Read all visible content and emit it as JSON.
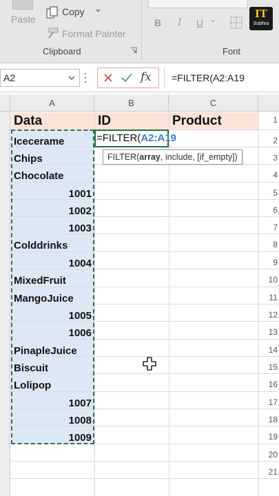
{
  "ribbon": {
    "paste_label": "Paste",
    "copy_label": "Copy",
    "copy_chevron": "⌄",
    "format_painter_label": "Format Painter",
    "clipboard_group": "Clipboard",
    "font_group": "Font",
    "bold": "B",
    "italic": "I",
    "underline": "U",
    "underline_chevron": "⌄",
    "logo_main": "IT",
    "logo_sub": "Subhra"
  },
  "formula_bar": {
    "name_box": "A2",
    "fx": "fx",
    "formula": "=FILTER(A2:A19"
  },
  "columns": [
    "A",
    "B",
    "C"
  ],
  "rows": [
    "1",
    "2",
    "3",
    "4",
    "5",
    "6",
    "7",
    "8",
    "9",
    "10",
    "11",
    "12",
    "13",
    "14",
    "15",
    "16",
    "17",
    "18",
    "19",
    "20",
    "21"
  ],
  "headers": {
    "data": "Data",
    "id": "ID",
    "product": "Product"
  },
  "cells": {
    "r2": "Icecerame",
    "r3": "Chips",
    "r4": "Chocolate",
    "r5": "1001",
    "r6": "1002",
    "r7": "1003",
    "r8": "Colddrinks",
    "r9": "1004",
    "r10": "MixedFruit",
    "r11": "MangoJuice",
    "r12": "1005",
    "r13": "1006",
    "r14": "PinapleJuice",
    "r15": "Biscuit",
    "r16": "Lolipop",
    "r17": "1007",
    "r18": "1008",
    "r19": "1009"
  },
  "editing": {
    "prefix": "=FILTER(",
    "ref": "A2:A19"
  },
  "tooltip": {
    "fn": "FILTER(",
    "arg1": "array",
    "rest": ", include, [if_empty])"
  },
  "colors": {
    "accent_green": "#217346",
    "range_fill": "#dde8f5",
    "header_fill": "#fbe3d8",
    "ref_blue": "#3a7dc9"
  }
}
